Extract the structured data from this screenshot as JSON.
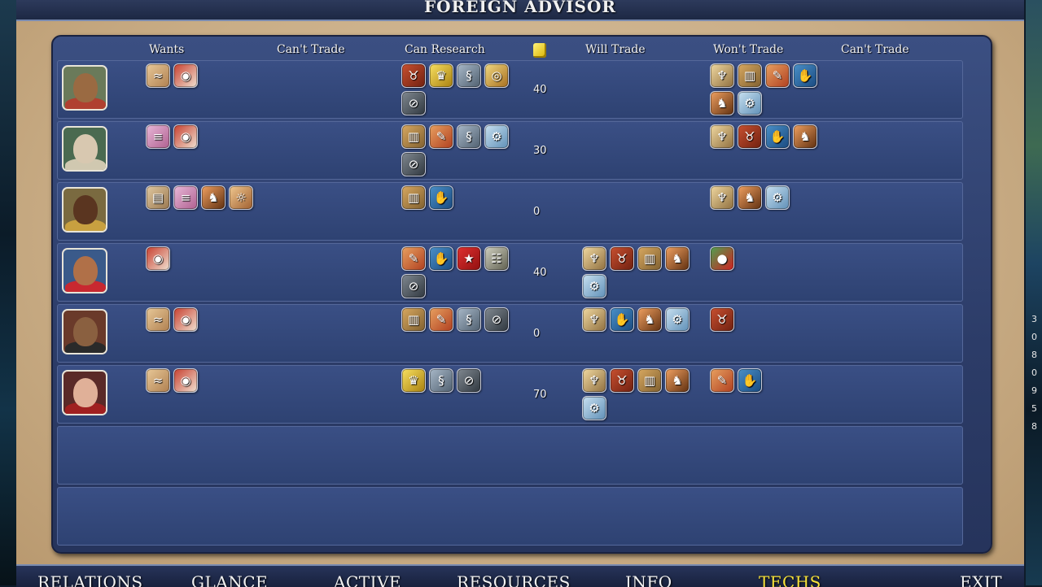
{
  "title": "FOREIGN ADVISOR",
  "headers": {
    "wants": "Wants",
    "cant_trade_1": "Can't Trade",
    "can_research": "Can Research",
    "gold_icon": "gold-coins-icon",
    "will_trade": "Will Trade",
    "wont_trade": "Won't Trade",
    "cant_trade_2": "Can't Trade"
  },
  "colors": {
    "portraits": [
      "#9a6a42",
      "#d8c8b0",
      "#5a3520",
      "#b07048",
      "#8a6040",
      "#e0b098"
    ],
    "portrait_bg": [
      "#6a7a5a",
      "#4a6a50",
      "#7a6a40",
      "#3a5a8a",
      "#6a3a2a",
      "#5a2a28"
    ],
    "portrait_body": [
      "#b04030",
      "#d0c8b0",
      "#c8a040",
      "#c82830",
      "#2a2a2a",
      "#a02020"
    ]
  },
  "tech_styles": {
    "ox": {
      "bg": "linear-gradient(135deg,#e8c898,#b08050)",
      "glyph": "≈"
    },
    "eye": {
      "bg": "linear-gradient(135deg,#c84030,#f0e0d0)",
      "glyph": "◉"
    },
    "scroll": {
      "bg": "linear-gradient(135deg,#e8b8d8,#b06090)",
      "glyph": "≡"
    },
    "buffalo": {
      "bg": "linear-gradient(135deg,#c85030,#702010)",
      "glyph": "♉"
    },
    "crown": {
      "bg": "linear-gradient(135deg,#f8e060,#a88010)",
      "glyph": "♛"
    },
    "snake": {
      "bg": "linear-gradient(135deg,#a8b8c8,#506070)",
      "glyph": "§"
    },
    "coins": {
      "bg": "linear-gradient(135deg,#f0d880,#a87020)",
      "glyph": "◎"
    },
    "wheel": {
      "bg": "linear-gradient(135deg,#808890,#303840)",
      "glyph": "⊘"
    },
    "parchment": {
      "bg": "linear-gradient(135deg,#e0c8a0,#9a7850)",
      "glyph": "▤"
    },
    "map": {
      "bg": "linear-gradient(135deg,#e8a060,#b04020)",
      "glyph": "✎"
    },
    "machine": {
      "bg": "linear-gradient(135deg,#c8e0f0,#6090b8)",
      "glyph": "⚙"
    },
    "hand": {
      "bg": "linear-gradient(135deg,#4a90c8,#1a4a80)",
      "glyph": "✋"
    },
    "tablet": {
      "bg": "linear-gradient(135deg,#d8a860,#806030)",
      "glyph": "▥"
    },
    "horse": {
      "bg": "linear-gradient(135deg,#f0a060,#603010)",
      "glyph": "♞"
    },
    "compass": {
      "bg": "linear-gradient(135deg,#f0c890,#a06030)",
      "glyph": "☼"
    },
    "idol": {
      "bg": "linear-gradient(135deg,#f0d8a0,#907040)",
      "glyph": "♆"
    },
    "flag": {
      "bg": "linear-gradient(135deg,#e03030,#901010)",
      "glyph": "★"
    },
    "ladder": {
      "bg": "linear-gradient(135deg,#d0d0c0,#606050)",
      "glyph": "☷"
    },
    "school": {
      "bg": "linear-gradient(135deg,#50a050,#d02020)",
      "glyph": "●"
    }
  },
  "rows": [
    {
      "leader": "native-chief-portrait",
      "wants": [
        "ox",
        "eye"
      ],
      "cant_trade": [],
      "can_research": [
        "buffalo",
        "crown",
        "snake",
        "coins",
        "wheel"
      ],
      "gold": "40",
      "will_trade": [],
      "wont_trade": [
        "idol",
        "tablet",
        "map",
        "hand",
        "horse",
        "machine"
      ],
      "cant_trade_2": []
    },
    {
      "leader": "roman-leader-portrait",
      "wants": [
        "scroll",
        "eye"
      ],
      "cant_trade": [],
      "can_research": [
        "tablet",
        "map",
        "snake",
        "machine",
        "wheel"
      ],
      "gold": "30",
      "will_trade": [],
      "wont_trade": [
        "idol",
        "buffalo",
        "hand",
        "horse"
      ],
      "cant_trade_2": []
    },
    {
      "leader": "african-king-portrait",
      "wants": [
        "parchment",
        "scroll",
        "horse",
        "compass"
      ],
      "cant_trade": [],
      "can_research": [
        "tablet",
        "hand"
      ],
      "gold": "0",
      "will_trade": [],
      "wont_trade": [
        "idol",
        "horse",
        "machine"
      ],
      "cant_trade_2": []
    },
    {
      "leader": "indian-leader-portrait",
      "wants": [
        "eye"
      ],
      "cant_trade": [],
      "can_research": [
        "map",
        "hand",
        "flag",
        "ladder",
        "wheel"
      ],
      "gold": "40",
      "will_trade": [
        "idol",
        "buffalo",
        "tablet",
        "horse",
        "machine"
      ],
      "wont_trade": [
        "school"
      ],
      "cant_trade_2": []
    },
    {
      "leader": "mongol-khan-portrait",
      "wants": [
        "ox",
        "eye"
      ],
      "cant_trade": [],
      "can_research": [
        "tablet",
        "map",
        "snake",
        "wheel"
      ],
      "gold": "0",
      "will_trade": [
        "idol",
        "hand",
        "horse",
        "machine"
      ],
      "wont_trade": [
        "buffalo"
      ],
      "cant_trade_2": []
    },
    {
      "leader": "queen-portrait",
      "wants": [
        "ox",
        "eye"
      ],
      "cant_trade": [],
      "can_research": [
        "crown",
        "snake",
        "wheel"
      ],
      "gold": "70",
      "will_trade": [
        "idol",
        "buffalo",
        "tablet",
        "horse",
        "machine"
      ],
      "wont_trade": [
        "map",
        "hand"
      ],
      "cant_trade_2": []
    }
  ],
  "tabs": [
    "RELATIONS",
    "GLANCE",
    "ACTIVE",
    "RESOURCES",
    "INFO",
    "TECHS",
    "EXIT"
  ],
  "active_tab": "TECHS",
  "side_numbers": [
    "3",
    "0",
    "8",
    "0",
    "9",
    "5",
    "8"
  ]
}
